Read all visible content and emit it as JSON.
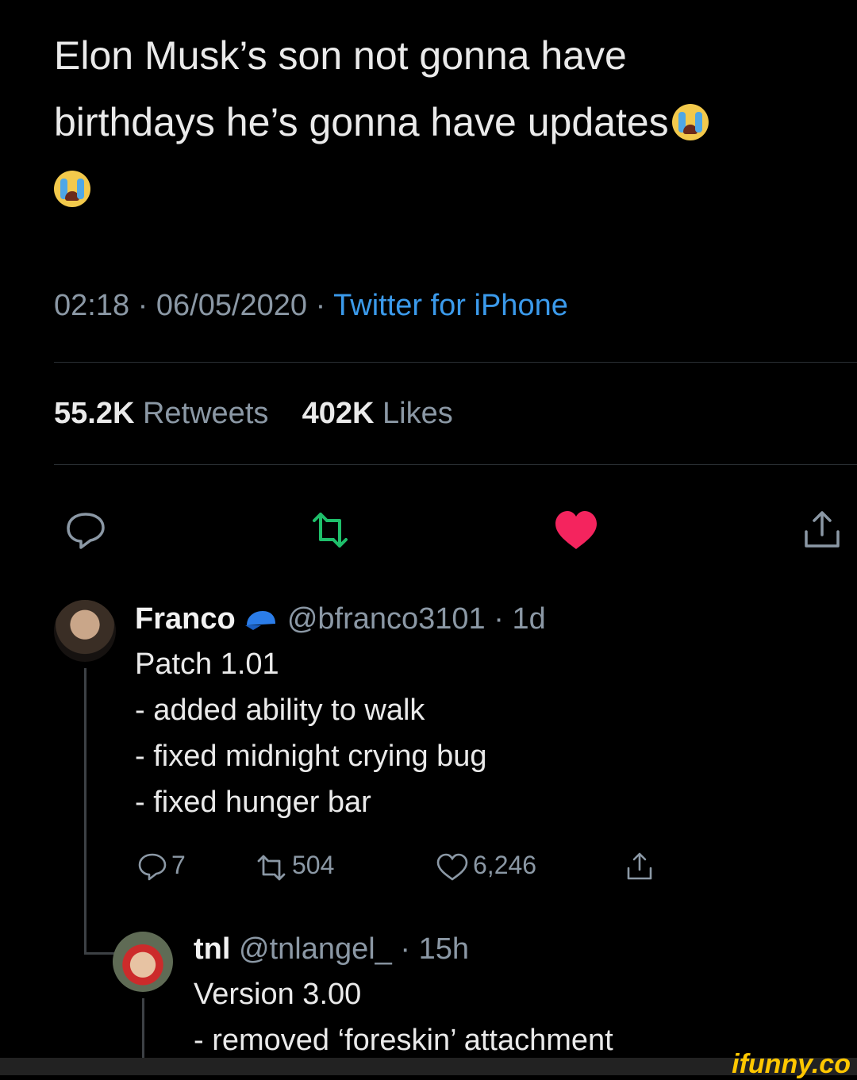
{
  "tweet": {
    "text_line1": "Elon Musk’s son not gonna have",
    "text_line2": "birthdays he’s gonna have updates",
    "time": "02:18",
    "date": "06/05/2020",
    "separator": " · ",
    "source": "Twitter for iPhone",
    "retweets_count": "55.2K",
    "retweets_label": "Retweets",
    "likes_count": "402K",
    "likes_label": "Likes",
    "emoji": "loudly-crying-face"
  },
  "actions": {
    "reply_icon": "speech-bubble-icon",
    "retweet_icon": "retweet-icon",
    "like_icon": "heart-icon",
    "share_icon": "share-icon",
    "retweet_color": "#1fbf6b",
    "like_color": "#f4245e"
  },
  "replies": [
    {
      "name": "Franco",
      "badge": "blue-cap-icon",
      "handle": "@bfranco3101",
      "age": "1d",
      "lines": [
        "Patch 1.01",
        "- added ability to walk",
        "- fixed midnight crying bug",
        "- fixed hunger bar"
      ],
      "reply_count": "7",
      "retweet_count": "504",
      "like_count": "6,246"
    },
    {
      "name": "tnl",
      "handle": "@tnlangel_",
      "age": "15h",
      "lines": [
        "Version 3.00",
        "- removed ‘foreskin’ attachment"
      ]
    }
  ],
  "watermark": "ifunny.co"
}
